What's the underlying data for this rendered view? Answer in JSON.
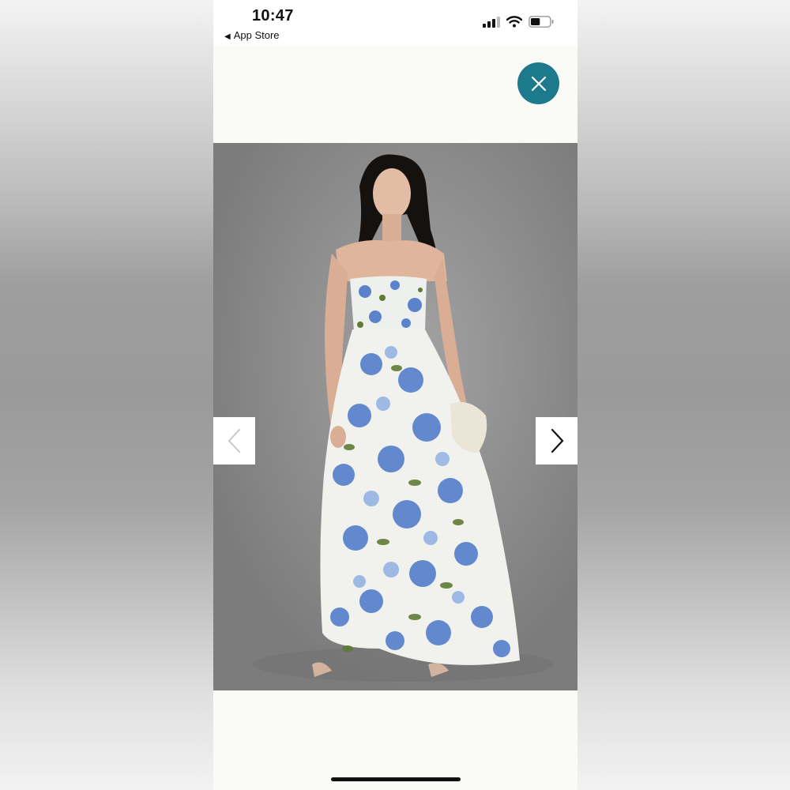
{
  "status_bar": {
    "time": "10:47",
    "back_label": "App Store",
    "icons": [
      "cellular-signal-icon",
      "wifi-icon",
      "battery-icon"
    ],
    "battery_level": 0.5
  },
  "viewer": {
    "close_icon": "close-icon",
    "prev_icon": "chevron-left-icon",
    "next_icon": "chevron-right-icon",
    "accent_color": "#1c7a8c"
  }
}
